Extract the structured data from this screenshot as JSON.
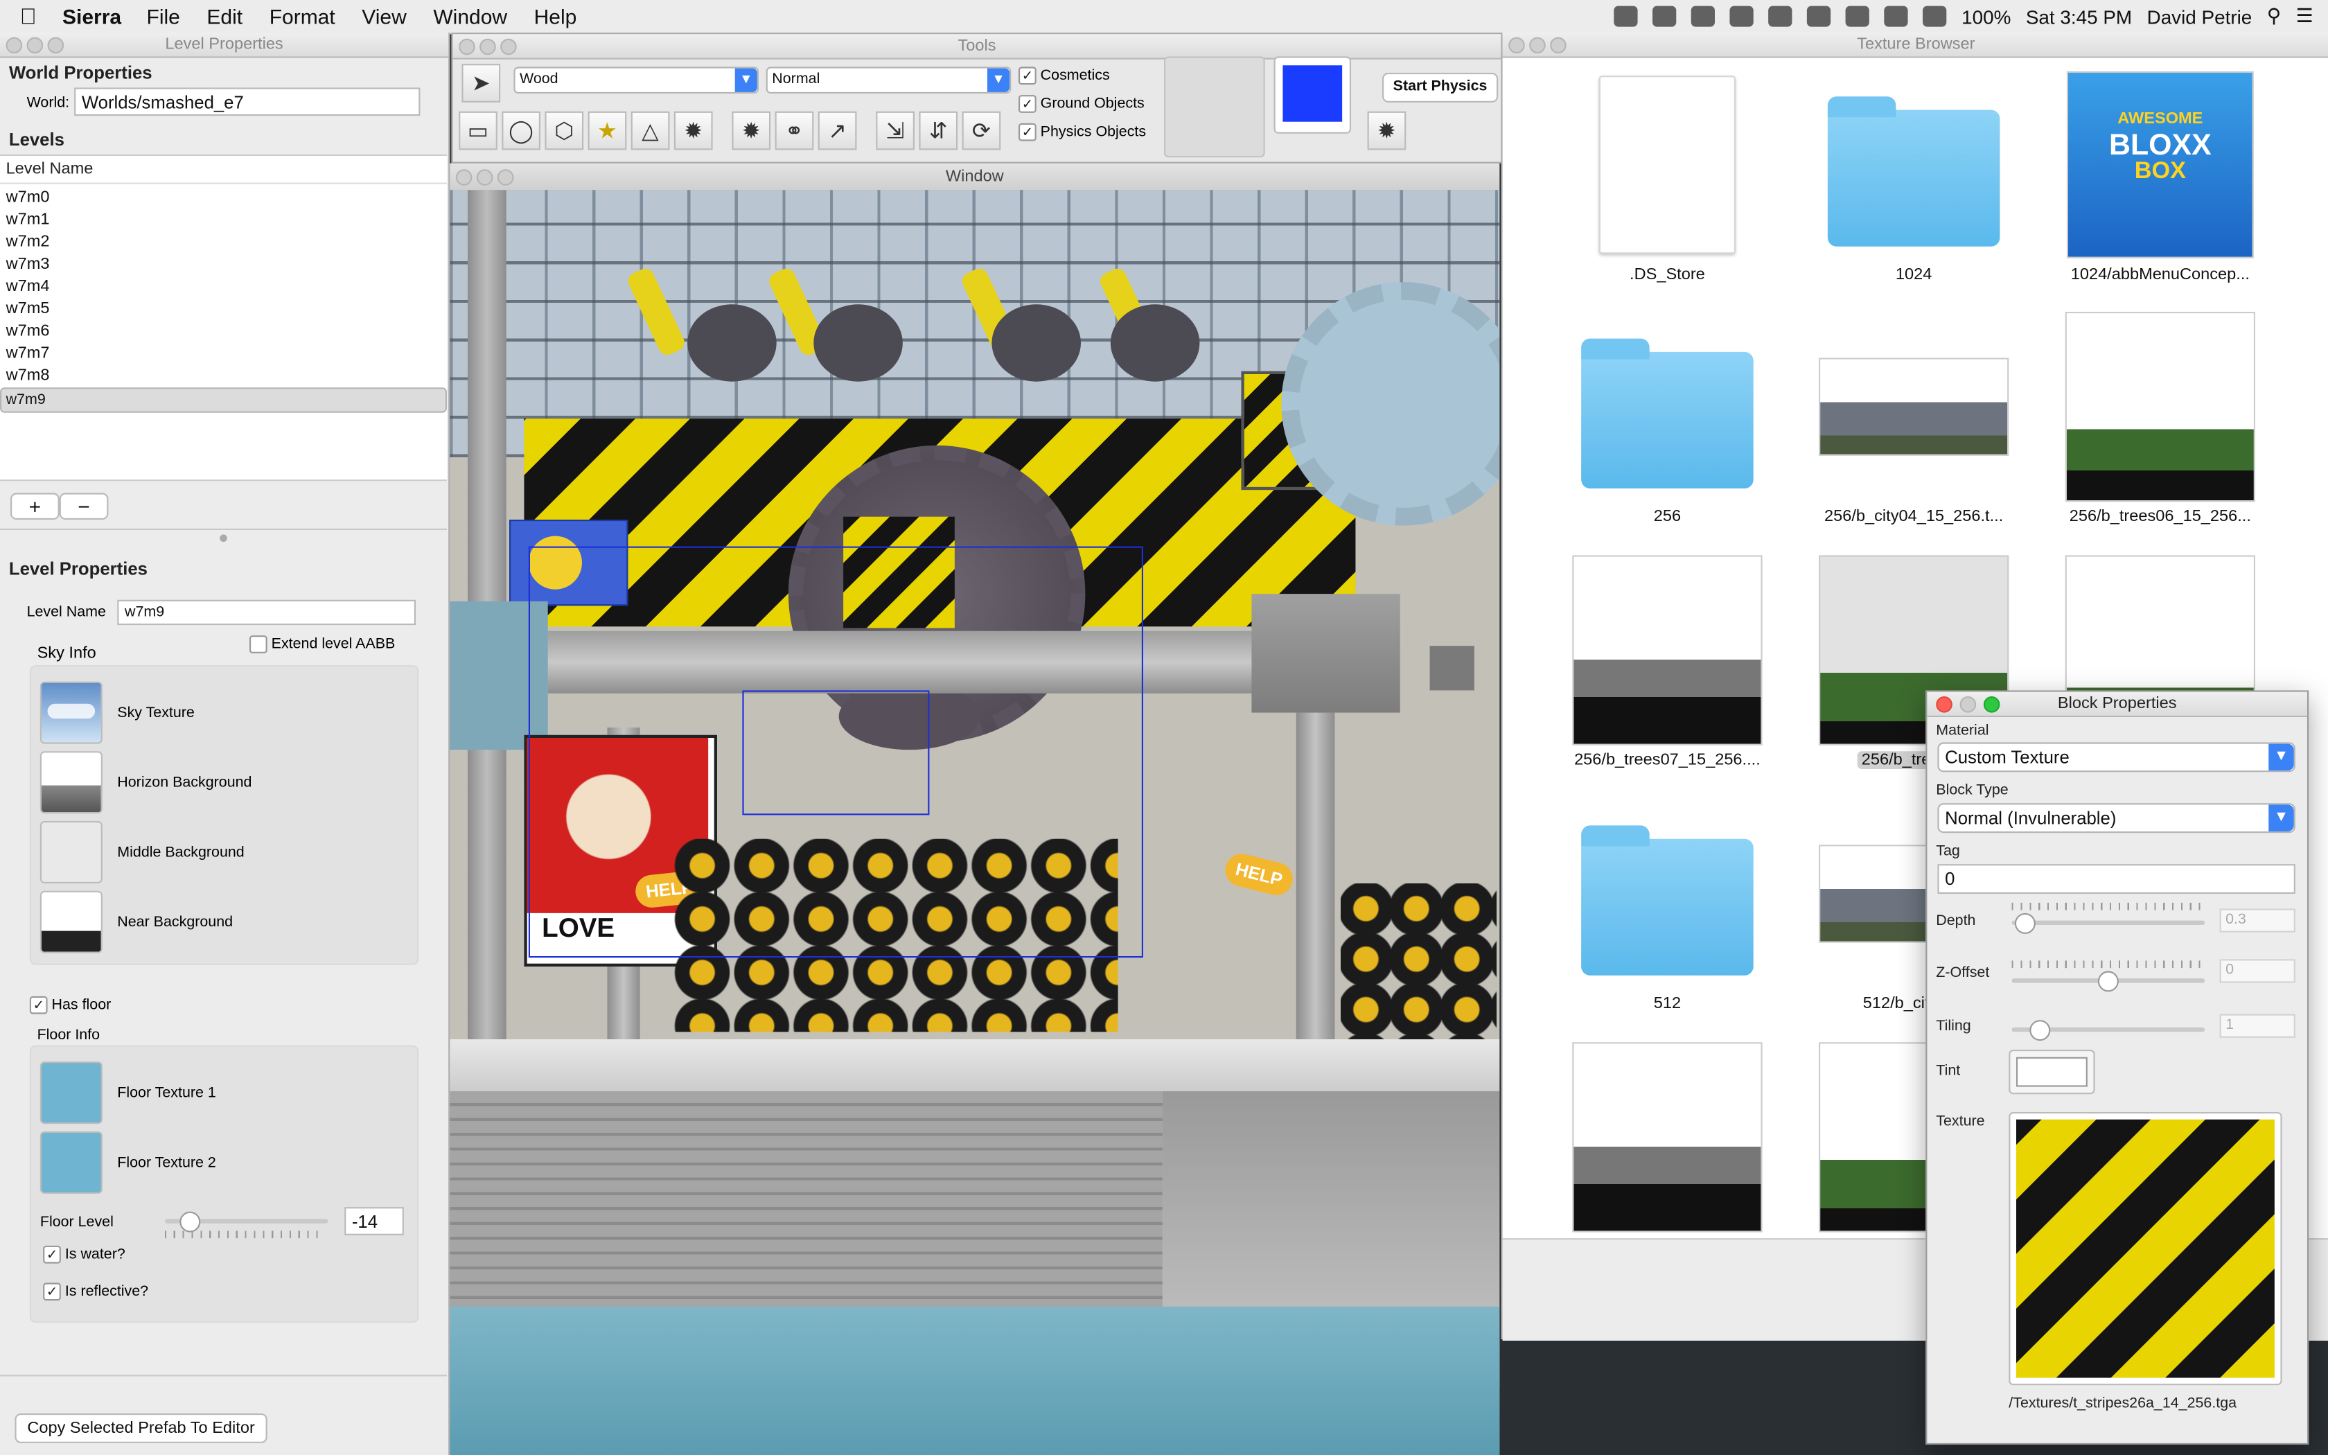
{
  "menubar": {
    "app": "Sierra",
    "items": [
      "File",
      "Edit",
      "Format",
      "View",
      "Window",
      "Help"
    ],
    "battery": "100%",
    "clock": "Sat 3:45 PM",
    "user": "David Petrie"
  },
  "level_panel": {
    "title": "Level Properties",
    "world_header": "World Properties",
    "world_label": "World:",
    "world_value": "Worlds/smashed_e7",
    "levels_header": "Levels",
    "column": "Level Name",
    "levels": [
      "w7m0",
      "w7m1",
      "w7m2",
      "w7m3",
      "w7m4",
      "w7m5",
      "w7m6",
      "w7m7",
      "w7m8",
      "w7m9"
    ],
    "selected_level": "w7m9",
    "add_label": "+",
    "remove_label": "−",
    "props_header": "Level Properties",
    "name_label": "Level Name",
    "name_value": "w7m9",
    "sky_info": "Sky Info",
    "extend_aabb": "Extend level AABB",
    "sky_items": [
      "Sky Texture",
      "Horizon Background",
      "Middle Background",
      "Near Background"
    ],
    "has_floor": "Has floor",
    "floor_info": "Floor Info",
    "floor_items": [
      "Floor Texture 1",
      "Floor Texture 2"
    ],
    "floor_level_label": "Floor Level",
    "floor_level_value": "-14",
    "is_water": "Is water?",
    "is_reflective": "Is reflective?",
    "copy_button": "Copy Selected Prefab To Editor"
  },
  "tools": {
    "title": "Tools",
    "material": "Wood",
    "mode": "Normal",
    "checks": [
      "Cosmetics",
      "Ground Objects",
      "Physics Objects"
    ],
    "start_physics": "Start Physics",
    "color_swatch": "#1a3cff"
  },
  "viewport": {
    "title": "Window",
    "poster_text": "LOVE",
    "help_text": "HELP"
  },
  "texture_browser": {
    "title": "Texture Browser",
    "tiles": [
      {
        "label": ".DS_Store",
        "kind": "file"
      },
      {
        "label": "1024",
        "kind": "folder"
      },
      {
        "label": "1024/abbMenuConcep...",
        "kind": "box"
      },
      {
        "label": "256",
        "kind": "folder"
      },
      {
        "label": "256/b_city04_15_256.t...",
        "kind": "city"
      },
      {
        "label": "256/b_trees06_15_256...",
        "kind": "trees"
      },
      {
        "label": "256/b_trees07_15_256....",
        "kind": "bare"
      },
      {
        "label": "256/b_trees08",
        "kind": "trees"
      },
      {
        "label": "",
        "kind": "trees"
      },
      {
        "label": "512",
        "kind": "folder"
      },
      {
        "label": "512/b_city04_",
        "kind": "city"
      },
      {
        "label": "",
        "kind": "bare"
      },
      {
        "label": "",
        "kind": "trees"
      }
    ],
    "box_art_text": [
      "AWESOME",
      "BLOXX",
      "BOX"
    ]
  },
  "block_properties": {
    "title": "Block Properties",
    "material_label": "Material",
    "material_value": "Custom Texture",
    "type_label": "Block Type",
    "type_value": "Normal (Invulnerable)",
    "tag_label": "Tag",
    "tag_value": "0",
    "depth_label": "Depth",
    "depth_value": "0.3",
    "zoffset_label": "Z-Offset",
    "zoffset_value": "0",
    "tiling_label": "Tiling",
    "tiling_value": "1",
    "tint_label": "Tint",
    "texture_label": "Texture",
    "texture_path": "/Textures/t_stripes26a_14_256.tga"
  }
}
